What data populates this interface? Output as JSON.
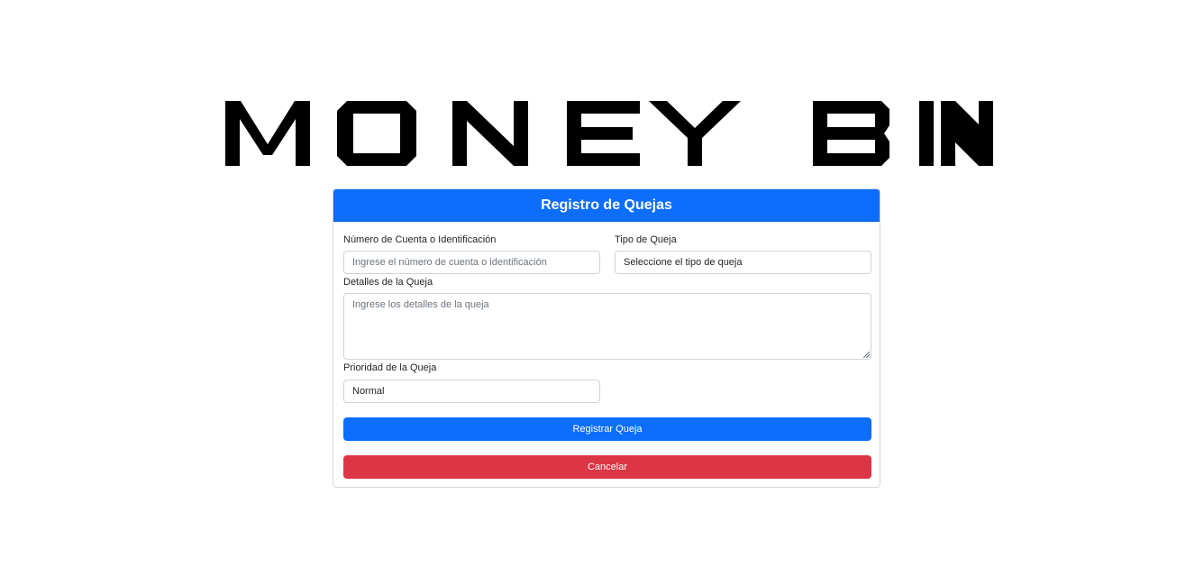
{
  "brand": {
    "logo_text": "MONEY BIN"
  },
  "form": {
    "title": "Registro de Quejas",
    "account": {
      "label": "Número de Cuenta o Identificación",
      "placeholder": "Ingrese el número de cuenta o identificación",
      "value": ""
    },
    "type": {
      "label": "Tipo de Queja",
      "selected": "Seleccione el tipo de queja"
    },
    "details": {
      "label": "Detalles de la Queja",
      "placeholder": "Ingrese los detalles de la queja",
      "value": ""
    },
    "priority": {
      "label": "Prioridad de la Queja",
      "selected": "Normal"
    },
    "submit_label": "Registrar Queja",
    "cancel_label": "Cancelar"
  },
  "colors": {
    "primary": "#0d6efd",
    "danger": "#dc3545",
    "logo": "#000000"
  }
}
